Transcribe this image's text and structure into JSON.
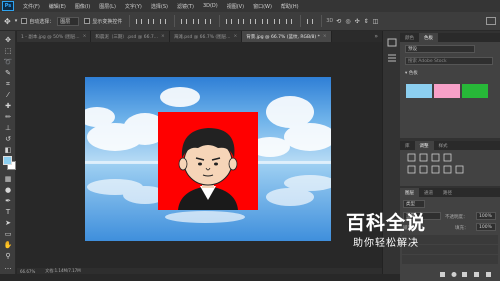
{
  "app": {
    "logo": "Ps"
  },
  "menu": [
    "文件(F)",
    "编辑(E)",
    "图像(I)",
    "图层(L)",
    "文字(Y)",
    "选择(S)",
    "滤镜(T)",
    "3D(D)",
    "视图(V)",
    "窗口(W)",
    "帮助(H)"
  ],
  "options": {
    "auto_select_label": "自动选择：",
    "auto_select_value": "图层",
    "show_transform_label": "显示变换控件"
  },
  "tabs": [
    {
      "label": "1 - 副本.jpg @ 50% (图层...",
      "active": false
    },
    {
      "label": "和晨泥（三期）.psd @ 66.7...",
      "active": false
    },
    {
      "label": "海滩.psd @ 66.7% (图层...",
      "active": false
    },
    {
      "label": "背景.jpg @ 66.7% (蓝纹, RGB/8) *",
      "active": true
    }
  ],
  "status": {
    "zoom": "66.67%",
    "doc": "文档:1.14M/7.17M"
  },
  "swatches_panel": {
    "tabs": [
      "颜色",
      "色板"
    ],
    "preset_select": "预设",
    "search_placeholder": "搜索 Adobe Stock",
    "group_label": "色板",
    "colors": [
      "#8ccff0",
      "#f7a1c8",
      "#27b838"
    ]
  },
  "adjustments_panel": {
    "tabs": [
      "库",
      "调整",
      "样式"
    ]
  },
  "layers_panel": {
    "tabs": [
      "图层",
      "通道",
      "路径"
    ],
    "filter_select": "类型",
    "blend_mode": "正常",
    "opacity_label": "不透明度：",
    "opacity_value": "100%",
    "lock_label": "锁定：",
    "fill_label": "填充：",
    "fill_value": "100%"
  },
  "colors": {
    "foreground": "#8ccff0",
    "background": "#ffffff",
    "portrait_bg": "#ff0000"
  },
  "watermark": {
    "line1": "百科全说",
    "line2": "助你轻松解决"
  }
}
